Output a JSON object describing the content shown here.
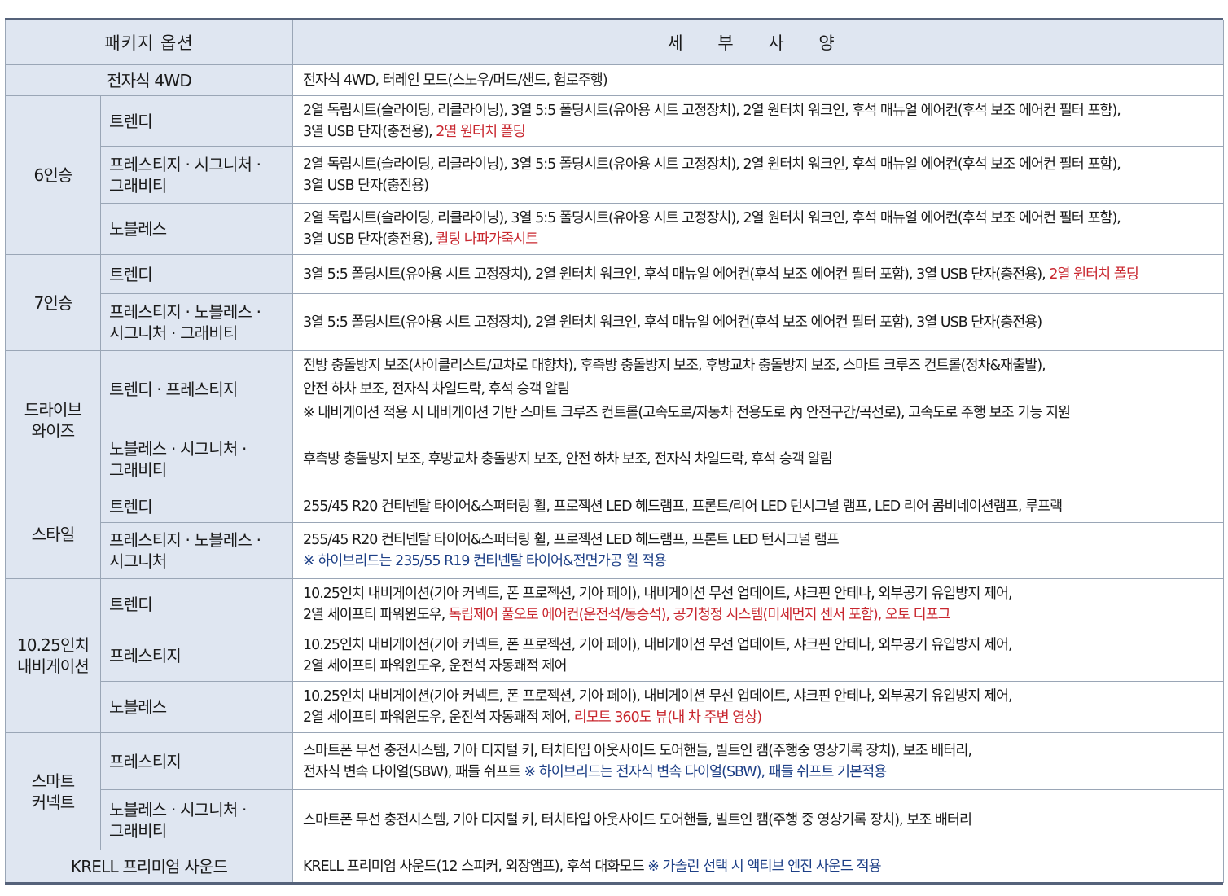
{
  "header": {
    "col1": "패키지 옵션",
    "col2": "세 부 사 양"
  },
  "rows": {
    "r1": {
      "category": "전자식 4WD",
      "detail": "전자식 4WD, 터레인 모드(스노우/머드/샌드, 험로주행)"
    },
    "seat6": {
      "category": "6인승",
      "trendy": {
        "label": "트렌디",
        "l1": "2열 독립시트(슬라이딩, 리클라이닝), 3열 5:5 폴딩시트(유아용 시트 고정장치), 2열 원터치 워크인, 후석 매뉴얼 에어컨(후석 보조 에어컨 필터 포함),",
        "l2": "3열 USB 단자(충전용), ",
        "l2_red": "2열 원터치 폴딩"
      },
      "prestige": {
        "label1": "프레스티지 · 시그니처 ·",
        "label2": "그래비티",
        "l1": "2열 독립시트(슬라이딩, 리클라이닝), 3열 5:5 폴딩시트(유아용 시트 고정장치), 2열 원터치 워크인, 후석 매뉴얼 에어컨(후석 보조 에어컨 필터 포함),",
        "l2": "3열 USB 단자(충전용)"
      },
      "noblesse": {
        "label": "노블레스",
        "l1": "2열 독립시트(슬라이딩, 리클라이닝), 3열 5:5 폴딩시트(유아용 시트 고정장치), 2열 원터치 워크인, 후석 매뉴얼 에어컨(후석 보조 에어컨 필터 포함),",
        "l2": "3열 USB 단자(충전용), ",
        "l2_red": "퀼팅 나파가죽시트"
      }
    },
    "seat7": {
      "category": "7인승",
      "trendy": {
        "label": "트렌디",
        "l1": "3열 5:5 폴딩시트(유아용 시트 고정장치), 2열 원터치 워크인, 후석 매뉴얼 에어컨(후석 보조 에어컨 필터 포함), 3열 USB 단자(충전용), ",
        "l1_red": "2열 원터치 폴딩"
      },
      "others": {
        "label1": "프레스티지 · 노블레스 ·",
        "label2": "시그니처 · 그래비티",
        "l1": "3열 5:5 폴딩시트(유아용 시트 고정장치), 2열 원터치 워크인, 후석 매뉴얼 에어컨(후석 보조 에어컨 필터 포함), 3열 USB 단자(충전용)"
      }
    },
    "drivewise": {
      "category1": "드라이브",
      "category2": "와이즈",
      "trendy": {
        "label": "트렌디 · 프레스티지",
        "l1": "전방 충돌방지 보조(사이클리스트/교차로 대향차), 후측방 충돌방지 보조, 후방교차 충돌방지 보조, 스마트 크루즈 컨트롤(정차&재출발),",
        "l2": "안전 하차 보조, 전자식 차일드락, 후석 승객 알림",
        "l3": "※ 내비게이션 적용 시 내비게이션 기반 스마트 크루즈 컨트롤(고속도로/자동차 전용도로 內 안전구간/곡선로), 고속도로 주행 보조 기능 지원"
      },
      "noblesse": {
        "label1": "노블레스 · 시그니처 ·",
        "label2": "그래비티",
        "l1": "후측방 충돌방지 보조, 후방교차 충돌방지 보조, 안전 하차 보조, 전자식 차일드락, 후석 승객 알림"
      }
    },
    "style": {
      "category": "스타일",
      "trendy": {
        "label": "트렌디",
        "l1": "255/45 R20 컨티넨탈 타이어&스퍼터링 휠, 프로젝션 LED 헤드램프, 프론트/리어 LED 턴시그널 램프, LED 리어 콤비네이션램프, 루프랙"
      },
      "others": {
        "label1": "프레스티지 · 노블레스 ·",
        "label2": "시그니처",
        "l1": "255/45 R20 컨티넨탈 타이어&스퍼터링 휠, 프로젝션 LED 헤드램프, 프론트 LED 턴시그널 램프",
        "l2_blue": "※ 하이브리드는 235/55 R19 컨티넨탈 타이어&전면가공 휠 적용"
      }
    },
    "navi": {
      "category1": "10.25인치",
      "category2": "내비게이션",
      "trendy": {
        "label": "트렌디",
        "l1": "10.25인치 내비게이션(기아 커넥트, 폰 프로젝션, 기아 페이), 내비게이션 무선 업데이트, 샤크핀 안테나, 외부공기 유입방지 제어,",
        "l2": "2열 세이프티 파워윈도우, ",
        "l2_red": "독립제어 풀오토 에어컨(운전석/동승석), 공기청정 시스템(미세먼지 센서 포함), 오토 디포그"
      },
      "prestige": {
        "label": "프레스티지",
        "l1": "10.25인치 내비게이션(기아 커넥트, 폰 프로젝션, 기아 페이), 내비게이션 무선 업데이트, 샤크핀 안테나, 외부공기 유입방지 제어,",
        "l2": "2열 세이프티 파워윈도우, 운전석 자동쾌적 제어"
      },
      "noblesse": {
        "label": "노블레스",
        "l1": "10.25인치 내비게이션(기아 커넥트, 폰 프로젝션, 기아 페이), 내비게이션 무선 업데이트, 샤크핀 안테나, 외부공기 유입방지 제어,",
        "l2": "2열 세이프티 파워윈도우, 운전석 자동쾌적 제어, ",
        "l2_red": "리모트 360도 뷰(내 차 주변 영상)"
      }
    },
    "smart": {
      "category1": "스마트",
      "category2": "커넥트",
      "prestige": {
        "label": "프레스티지",
        "l1": "스마트폰 무선 충전시스템, 기아 디지털 키, 터치타입 아웃사이드 도어핸들, 빌트인 캠(주행중 영상기록 장치), 보조 배터리,",
        "l2": "전자식 변속 다이얼(SBW), 패들 쉬프트  ",
        "l2_blue": "※ 하이브리드는 전자식 변속 다이얼(SBW), 패들 쉬프트 기본적용"
      },
      "noblesse": {
        "label1": "노블레스 · 시그니처 ·",
        "label2": "그래비티",
        "l1": "스마트폰 무선 충전시스템, 기아 디지털 키, 터치타입 아웃사이드 도어핸들, 빌트인 캠(주행 중 영상기록 장치), 보조 배터리"
      }
    },
    "krell": {
      "category": "KRELL 프리미엄 사운드",
      "l1": "KRELL 프리미엄 사운드(12 스피커, 외장앰프), 후석 대화모드  ",
      "l1_blue": "※ 가솔린 선택 시 액티브 엔진 사운드 적용"
    }
  },
  "colors": {
    "header_bg": "#dfe6f1",
    "border": "#9aa6b6",
    "accent_red": "#c8262e",
    "accent_blue": "#1d3f86"
  }
}
